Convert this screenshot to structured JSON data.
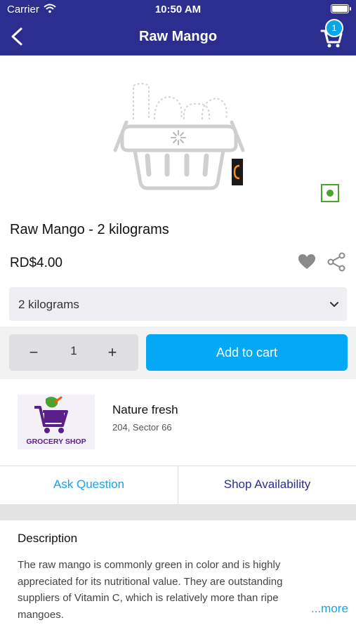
{
  "status_bar": {
    "carrier": "Carrier",
    "time": "10:50 AM"
  },
  "header": {
    "title": "Raw Mango",
    "cart_count": "1"
  },
  "product": {
    "name": "Raw Mango - 2 kilograms",
    "price": "RD$4.00",
    "variant": "2 kilograms",
    "quantity": "1",
    "add_to_cart_label": "Add to cart",
    "is_veg": true
  },
  "seller": {
    "name": "Nature fresh",
    "address": "204, Sector 66",
    "logo_text": "GROCERY SHOP"
  },
  "links": {
    "ask_question": "Ask Question",
    "shop_availability": "Shop Availability"
  },
  "description": {
    "title": "Description",
    "text": "The raw mango is commonly green in color and is highly appreciated for its nutritional value. They are outstanding suppliers of Vitamin C, which is relatively more than ripe mangoes.",
    "more_label": "...more"
  },
  "colors": {
    "header_bg": "#2b2d8f",
    "accent": "#03a9f4",
    "veg_green": "#4aa32c"
  }
}
